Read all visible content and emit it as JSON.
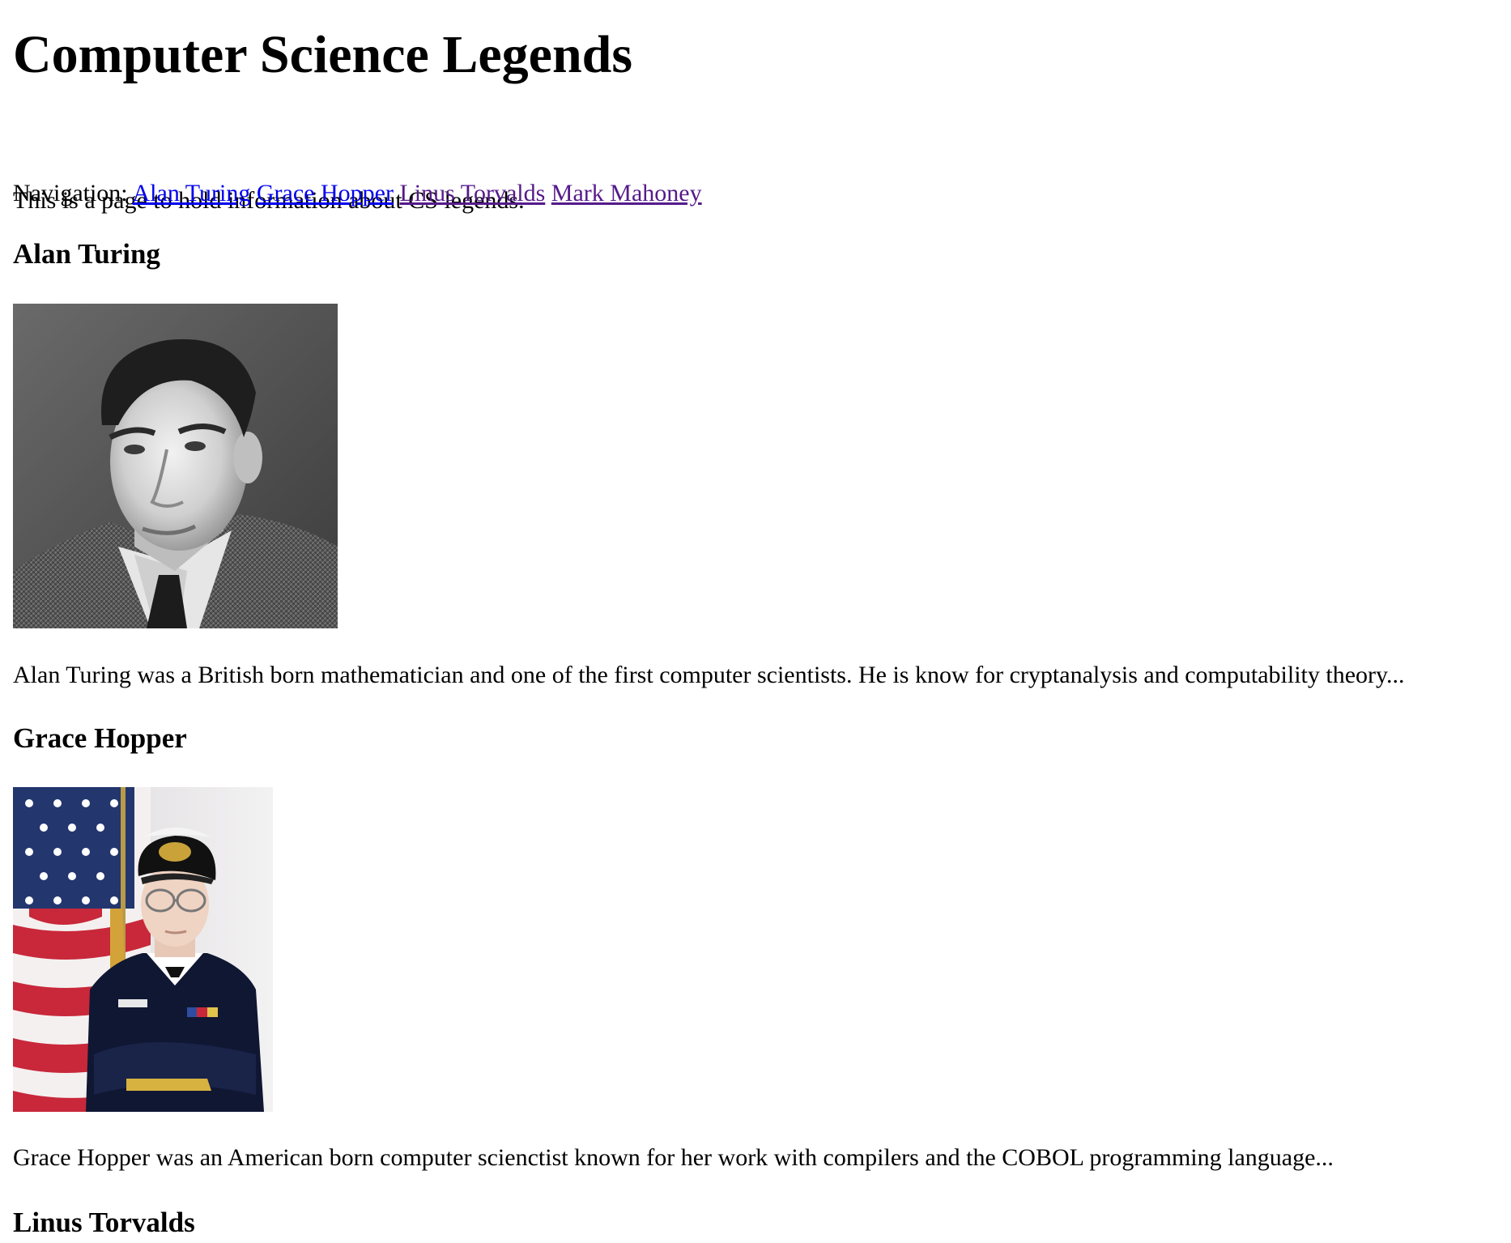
{
  "page": {
    "title": "Computer Science Legends",
    "intro": "This is a page to hold information about CS legends.",
    "nav_label": "Navigation:",
    "nav_links": [
      {
        "label": "Alan Turing",
        "visited": false
      },
      {
        "label": "Grace Hopper",
        "visited": false
      },
      {
        "label": "Linus Torvalds",
        "visited": true
      },
      {
        "label": "Mark Mahoney",
        "visited": true
      }
    ]
  },
  "sections": [
    {
      "heading": "Alan Turing",
      "image": "alan-turing-portrait",
      "description": "Alan Turing was a British born mathematician and one of the first computer scientists. He is know for cryptanalysis and computability theory..."
    },
    {
      "heading": "Grace Hopper",
      "image": "grace-hopper-portrait",
      "description": "Grace Hopper was an American born computer scienctist known for her work with compilers and the COBOL programming language..."
    },
    {
      "heading": "Linus Torvalds"
    }
  ],
  "colors": {
    "link": "#0000ee",
    "visited_link": "#551a8b"
  }
}
